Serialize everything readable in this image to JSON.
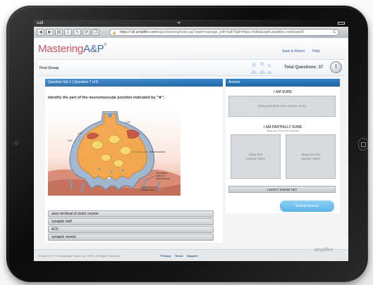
{
  "statusbar": {
    "carrier": "uall",
    "wifi": "ᯤ"
  },
  "browser": {
    "url_host": "https:// ktl.amplifire.com",
    "url_path": "/apps/learning/index.jsp?path=manage_pdf=/pdf/?pdf=https://mlf/qlaspdf.amplifire.com/learn/4",
    "reload": "C",
    "icons": [
      "back-icon",
      "forward-icon",
      "bookmark-book-icon",
      "share-icon",
      "tools-icon",
      "sync-icon",
      "pages-icon"
    ],
    "lock": "🔒"
  },
  "app": {
    "logo_main": "Mastering",
    "logo_ap": "A&P",
    "logo_mark": "®",
    "save_return": "Save & Return",
    "help": "Help"
  },
  "group": {
    "name": "First Group",
    "total_questions": "Total Questions: 37"
  },
  "question": {
    "tab": "Question Set 1  |  Question 7 of 8",
    "prompt": "Identify the part of the neuromuscular junction indicated by \"★\".",
    "figure_labels": {
      "ca1": "Ca²⁺",
      "ca2": "Ca²⁺",
      "ca3": "Ca²⁺",
      "mito": "Mitochondrion",
      "junctional": "Junctional\nfolds of\nsarcolemma",
      "sarco": "Sarcoplasm of\nmuscle fiber"
    },
    "choices": [
      "axon terminal of motor neuron",
      "synaptic cleft",
      "ACh",
      "synaptic vesicle"
    ]
  },
  "answer": {
    "tab": "Answer",
    "sure_label": "I AM SURE",
    "sure_drop": "(drag and drop your answer here)",
    "partially_label": "I AM PARTIALLY SURE",
    "partially_sub": "(drag your best two answers)",
    "drop_first": "(drag first\nanswer here)",
    "drop_second": "(drag second\nanswer here)",
    "dont_know": "I DON'T KNOW YET",
    "submit": "Submit Answer"
  },
  "footer": {
    "copyright": "Version 5.0.0 ® Knowledge Factor, Inc. 2013. All Rights Reserved.",
    "privacy": "Privacy",
    "terms": "Terms",
    "support": "Support",
    "brand": "amplifire"
  },
  "colors": {
    "accent_blue": "#1f6db3",
    "logo_red": "#c52a33",
    "submit_blue": "#6cc0ec"
  }
}
